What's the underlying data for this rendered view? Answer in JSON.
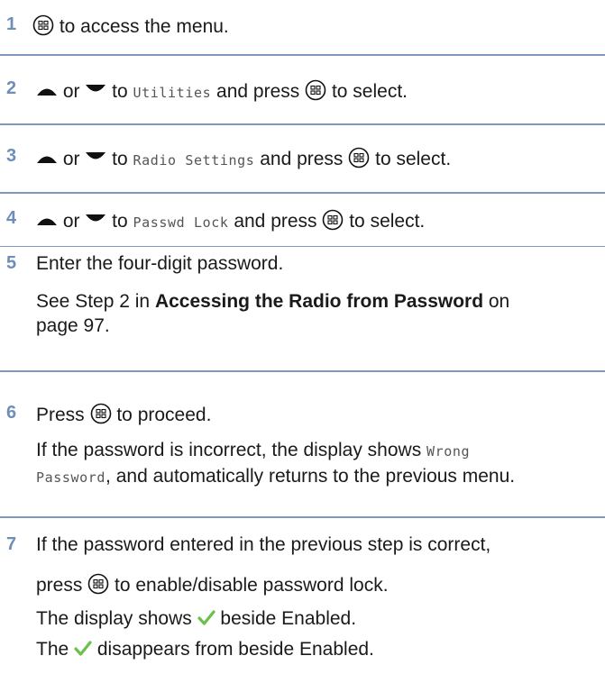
{
  "steps": [
    {
      "num": "1",
      "t1": " to access the menu."
    },
    {
      "num": "2",
      "t1": " or ",
      "t2": " to ",
      "mono": "Utilities",
      "t3": " and press ",
      "t4": " to select."
    },
    {
      "num": "3",
      "t1": " or ",
      "t2": " to ",
      "mono": "Radio Settings",
      "t3": " and press ",
      "t4": " to select."
    },
    {
      "num": "4",
      "t1": " or ",
      "t2": " to ",
      "mono": "Passwd Lock",
      "t3": " and press ",
      "t4": " to select."
    },
    {
      "num": "5",
      "t1": "Enter the four-digit password.",
      "p1": "See Step 2 in ",
      "p1_bold": "Accessing the Radio from Password",
      "p1_end": " on",
      "p2": "page 97."
    },
    {
      "num": "6",
      "t1": "Press ",
      "t2": " to proceed.",
      "p1": "If the password is incorrect, the display shows ",
      "p1_mono": "Wrong",
      "p2_mono": "Password",
      "p2": ", and automatically returns to the previous menu."
    },
    {
      "num": "7",
      "t1": "If the password entered in the previous step is correct,",
      "t2": "press ",
      "t3": " to enable/disable password lock.",
      "p1": "The display shows ",
      "p1_end": " beside Enabled.",
      "p2": "The ",
      "p2_end": " disappears from beside Enabled."
    }
  ],
  "icons": {
    "menu_key": "menu-ok-button-icon",
    "up": "up-arrow-icon",
    "down": "down-arrow-icon",
    "check": "checkmark-icon"
  },
  "colors": {
    "step_number": "#6d8eb8",
    "rule": "#7f98bd",
    "check": "#6cc04a"
  }
}
